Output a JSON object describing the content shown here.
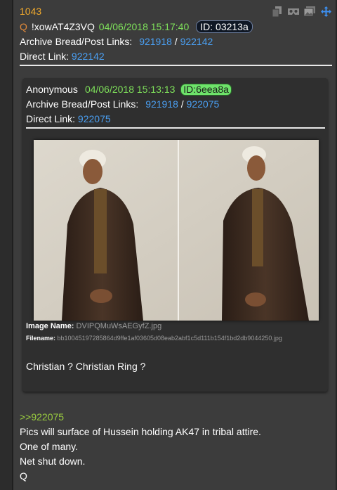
{
  "post": {
    "number": "1043",
    "q_label": "Q",
    "tripcode": "!xowAT4Z3VQ",
    "datetime": "04/06/2018 15:17:40",
    "id_label": "ID: 03213a",
    "archive_label": "Archive Bread/Post Links:",
    "archive_link_1": "921918",
    "separator": "/",
    "archive_link_2": "922142",
    "direct_label": "Direct Link:",
    "direct_link": "922142",
    "reply_ref": ">>922075",
    "body": [
      "Pics will surface of Hussein holding AK47 in tribal attire.",
      "One of many.",
      "Net shut down.",
      "Q"
    ]
  },
  "toolbar": {
    "icons": [
      "copy-icon",
      "vr-icon",
      "images-icon",
      "move-icon"
    ]
  },
  "quoted": {
    "author": "Anonymous",
    "datetime": "04/06/2018 15:13:13",
    "id_label": "ID:6eea8a",
    "archive_label": "Archive Bread/Post Links:",
    "archive_link_1": "921918",
    "separator": "/",
    "archive_link_2": "922075",
    "direct_label": "Direct Link:",
    "direct_link": "922075",
    "image_name_label": "Image Name:",
    "image_name": "DVIPQMuWsAEGyfZ.jpg",
    "filename_label": "Filename:",
    "filename": "bb10045197285864d9ffe1af03605d08eab2abf1c5d111b154f1bd2db9044250.jpg",
    "message": "Christian ? Christian Ring ?"
  },
  "colors": {
    "post_bg": "#3c3c3c",
    "quote_bg": "#2f2f2f",
    "link": "#4a9ff2",
    "date": "#7ee05a",
    "number": "#f0a92c",
    "greentext": "#9bce3f"
  }
}
